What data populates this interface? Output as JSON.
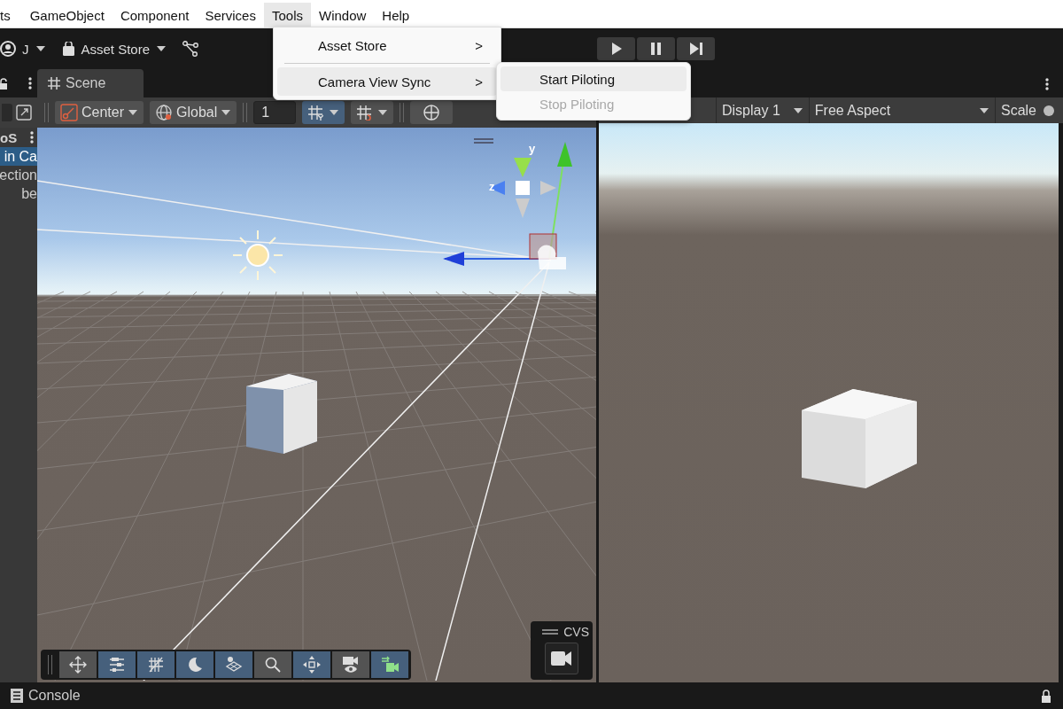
{
  "menu_bar": {
    "items": [
      {
        "label": "ts",
        "selected": false
      },
      {
        "label": "GameObject",
        "selected": false
      },
      {
        "label": "Component",
        "selected": false
      },
      {
        "label": "Services",
        "selected": false
      },
      {
        "label": "Tools",
        "selected": true
      },
      {
        "label": "Window",
        "selected": false
      },
      {
        "label": "Help",
        "selected": false
      }
    ]
  },
  "open_menu": {
    "items": [
      {
        "kind": "submenu",
        "label": "Asset Store",
        "arrow": ">",
        "highlighted": false
      },
      {
        "kind": "separator"
      },
      {
        "kind": "submenu",
        "label": "Camera View Sync",
        "arrow": ">",
        "highlighted": true
      }
    ]
  },
  "submenu": {
    "items": [
      {
        "label": "Start Piloting",
        "highlighted": true,
        "disabled": false
      },
      {
        "label": "Stop Piloting",
        "highlighted": false,
        "disabled": true
      }
    ]
  },
  "toolbar": {
    "account": "J",
    "asset_store": "Asset Store"
  },
  "play_controls": [
    {
      "kind": "play"
    },
    {
      "kind": "pause"
    },
    {
      "kind": "step"
    }
  ],
  "hierarchy": {
    "title": "oS",
    "items": [
      {
        "label": "in Ca",
        "selected": true
      },
      {
        "label": "ection",
        "selected": false
      },
      {
        "label": "be",
        "selected": false
      }
    ]
  },
  "scene_tab": {
    "label": "Scene",
    "selected": true
  },
  "scene_toolbar": {
    "pivot": "Center",
    "space": "Global",
    "grid_size": "1",
    "grid_snapping_on": true,
    "increment_snap_on": false
  },
  "gizmo": {
    "y_label": "y",
    "z_label": "z"
  },
  "overlay_toolbar": [
    {
      "kind": "move",
      "on": false
    },
    {
      "kind": "sliders",
      "on": true
    },
    {
      "kind": "grid",
      "on": true
    },
    {
      "kind": "moon",
      "on": true
    },
    {
      "kind": "layers",
      "on": true
    },
    {
      "kind": "search",
      "on": false
    },
    {
      "kind": "pivot",
      "on": true
    },
    {
      "kind": "camera-eye",
      "on": false
    },
    {
      "kind": "camera-sync",
      "on": true
    }
  ],
  "cvs_overlay": {
    "title": "CVS"
  },
  "game_toolbar": {
    "display": "Display 1",
    "aspect": "Free Aspect",
    "scale": "Scale",
    "scale_slider": {
      "level": 0
    }
  },
  "status_bar": {
    "console": "Console"
  }
}
